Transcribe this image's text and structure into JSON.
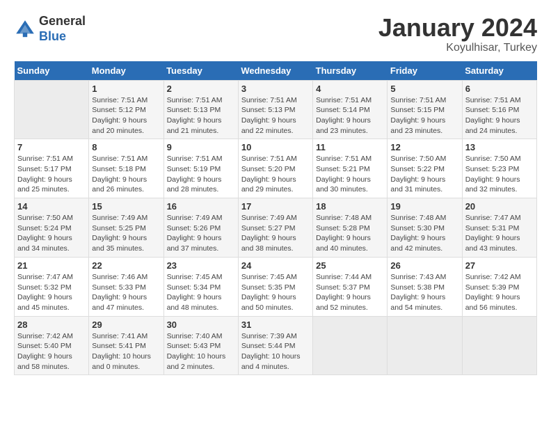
{
  "header": {
    "logo_general": "General",
    "logo_blue": "Blue",
    "month": "January 2024",
    "location": "Koyulhisar, Turkey"
  },
  "days_of_week": [
    "Sunday",
    "Monday",
    "Tuesday",
    "Wednesday",
    "Thursday",
    "Friday",
    "Saturday"
  ],
  "weeks": [
    [
      {
        "day": "",
        "info": ""
      },
      {
        "day": "1",
        "info": "Sunrise: 7:51 AM\nSunset: 5:12 PM\nDaylight: 9 hours\nand 20 minutes."
      },
      {
        "day": "2",
        "info": "Sunrise: 7:51 AM\nSunset: 5:13 PM\nDaylight: 9 hours\nand 21 minutes."
      },
      {
        "day": "3",
        "info": "Sunrise: 7:51 AM\nSunset: 5:13 PM\nDaylight: 9 hours\nand 22 minutes."
      },
      {
        "day": "4",
        "info": "Sunrise: 7:51 AM\nSunset: 5:14 PM\nDaylight: 9 hours\nand 23 minutes."
      },
      {
        "day": "5",
        "info": "Sunrise: 7:51 AM\nSunset: 5:15 PM\nDaylight: 9 hours\nand 23 minutes."
      },
      {
        "day": "6",
        "info": "Sunrise: 7:51 AM\nSunset: 5:16 PM\nDaylight: 9 hours\nand 24 minutes."
      }
    ],
    [
      {
        "day": "7",
        "info": "Sunrise: 7:51 AM\nSunset: 5:17 PM\nDaylight: 9 hours\nand 25 minutes."
      },
      {
        "day": "8",
        "info": "Sunrise: 7:51 AM\nSunset: 5:18 PM\nDaylight: 9 hours\nand 26 minutes."
      },
      {
        "day": "9",
        "info": "Sunrise: 7:51 AM\nSunset: 5:19 PM\nDaylight: 9 hours\nand 28 minutes."
      },
      {
        "day": "10",
        "info": "Sunrise: 7:51 AM\nSunset: 5:20 PM\nDaylight: 9 hours\nand 29 minutes."
      },
      {
        "day": "11",
        "info": "Sunrise: 7:51 AM\nSunset: 5:21 PM\nDaylight: 9 hours\nand 30 minutes."
      },
      {
        "day": "12",
        "info": "Sunrise: 7:50 AM\nSunset: 5:22 PM\nDaylight: 9 hours\nand 31 minutes."
      },
      {
        "day": "13",
        "info": "Sunrise: 7:50 AM\nSunset: 5:23 PM\nDaylight: 9 hours\nand 32 minutes."
      }
    ],
    [
      {
        "day": "14",
        "info": "Sunrise: 7:50 AM\nSunset: 5:24 PM\nDaylight: 9 hours\nand 34 minutes."
      },
      {
        "day": "15",
        "info": "Sunrise: 7:49 AM\nSunset: 5:25 PM\nDaylight: 9 hours\nand 35 minutes."
      },
      {
        "day": "16",
        "info": "Sunrise: 7:49 AM\nSunset: 5:26 PM\nDaylight: 9 hours\nand 37 minutes."
      },
      {
        "day": "17",
        "info": "Sunrise: 7:49 AM\nSunset: 5:27 PM\nDaylight: 9 hours\nand 38 minutes."
      },
      {
        "day": "18",
        "info": "Sunrise: 7:48 AM\nSunset: 5:28 PM\nDaylight: 9 hours\nand 40 minutes."
      },
      {
        "day": "19",
        "info": "Sunrise: 7:48 AM\nSunset: 5:30 PM\nDaylight: 9 hours\nand 42 minutes."
      },
      {
        "day": "20",
        "info": "Sunrise: 7:47 AM\nSunset: 5:31 PM\nDaylight: 9 hours\nand 43 minutes."
      }
    ],
    [
      {
        "day": "21",
        "info": "Sunrise: 7:47 AM\nSunset: 5:32 PM\nDaylight: 9 hours\nand 45 minutes."
      },
      {
        "day": "22",
        "info": "Sunrise: 7:46 AM\nSunset: 5:33 PM\nDaylight: 9 hours\nand 47 minutes."
      },
      {
        "day": "23",
        "info": "Sunrise: 7:45 AM\nSunset: 5:34 PM\nDaylight: 9 hours\nand 48 minutes."
      },
      {
        "day": "24",
        "info": "Sunrise: 7:45 AM\nSunset: 5:35 PM\nDaylight: 9 hours\nand 50 minutes."
      },
      {
        "day": "25",
        "info": "Sunrise: 7:44 AM\nSunset: 5:37 PM\nDaylight: 9 hours\nand 52 minutes."
      },
      {
        "day": "26",
        "info": "Sunrise: 7:43 AM\nSunset: 5:38 PM\nDaylight: 9 hours\nand 54 minutes."
      },
      {
        "day": "27",
        "info": "Sunrise: 7:42 AM\nSunset: 5:39 PM\nDaylight: 9 hours\nand 56 minutes."
      }
    ],
    [
      {
        "day": "28",
        "info": "Sunrise: 7:42 AM\nSunset: 5:40 PM\nDaylight: 9 hours\nand 58 minutes."
      },
      {
        "day": "29",
        "info": "Sunrise: 7:41 AM\nSunset: 5:41 PM\nDaylight: 10 hours\nand 0 minutes."
      },
      {
        "day": "30",
        "info": "Sunrise: 7:40 AM\nSunset: 5:43 PM\nDaylight: 10 hours\nand 2 minutes."
      },
      {
        "day": "31",
        "info": "Sunrise: 7:39 AM\nSunset: 5:44 PM\nDaylight: 10 hours\nand 4 minutes."
      },
      {
        "day": "",
        "info": ""
      },
      {
        "day": "",
        "info": ""
      },
      {
        "day": "",
        "info": ""
      }
    ]
  ]
}
